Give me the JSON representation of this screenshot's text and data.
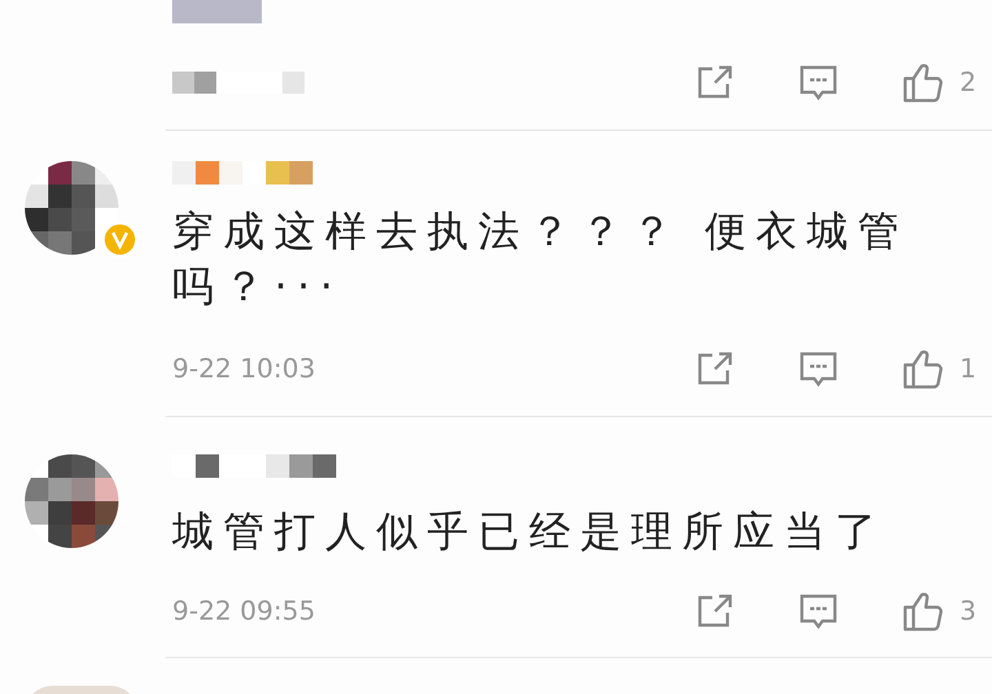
{
  "comments": [
    {
      "kind": "partial",
      "likes": "2"
    },
    {
      "kind": "full",
      "verified": true,
      "text": "穿成这样去执法？？？ 便衣城管吗？···",
      "time": "9-22 10:03",
      "likes": "1"
    },
    {
      "kind": "full",
      "verified": false,
      "text": "城管打人似乎已经是理所应当了",
      "time": "9-22 09:55",
      "likes": "3"
    }
  ]
}
